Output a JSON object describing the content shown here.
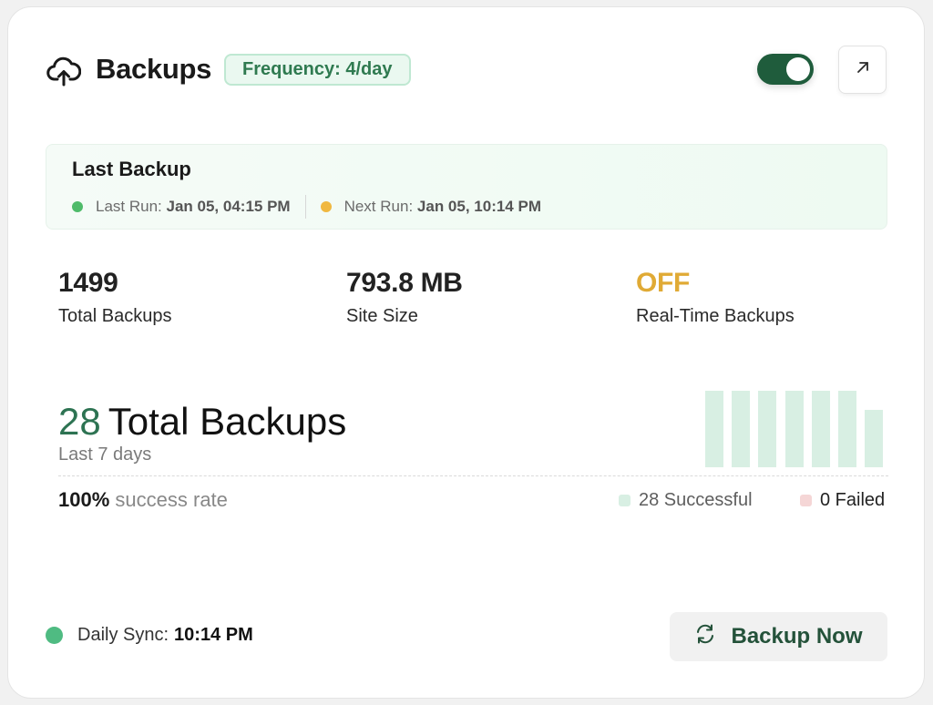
{
  "header": {
    "title": "Backups",
    "frequency_badge": "Frequency: 4/day",
    "toggle_on": true
  },
  "last_backup": {
    "title": "Last Backup",
    "last_run_label": "Last Run:",
    "last_run_value": "Jan 05, 04:15 PM",
    "next_run_label": "Next Run:",
    "next_run_value": "Jan 05, 10:14 PM"
  },
  "stats": [
    {
      "value": "1499",
      "label": "Total Backups",
      "color": "#222222"
    },
    {
      "value": "793.8 MB",
      "label": "Site Size",
      "color": "#222222"
    },
    {
      "value": "OFF",
      "label": "Real-Time Backups",
      "color": "#e0aa35"
    }
  ],
  "summary": {
    "count": "28",
    "count_label": "Total Backups",
    "period": "Last 7 days",
    "success_pct": "100%",
    "success_text": "success rate",
    "successful": "28 Successful",
    "failed": "0 Failed"
  },
  "mini_chart": {
    "values": [
      1,
      1,
      1,
      1,
      1,
      1,
      0.75
    ]
  },
  "footer": {
    "sync_label": "Daily Sync:",
    "sync_time": "10:14 PM",
    "backup_button": "Backup Now"
  },
  "colors": {
    "accent": "#1f5c3c",
    "success": "#4fbb82",
    "warning": "#e0aa35",
    "badge_bg": "#eaf8f0",
    "failed": "#f5d6d6",
    "successful": "#d8efe3"
  }
}
